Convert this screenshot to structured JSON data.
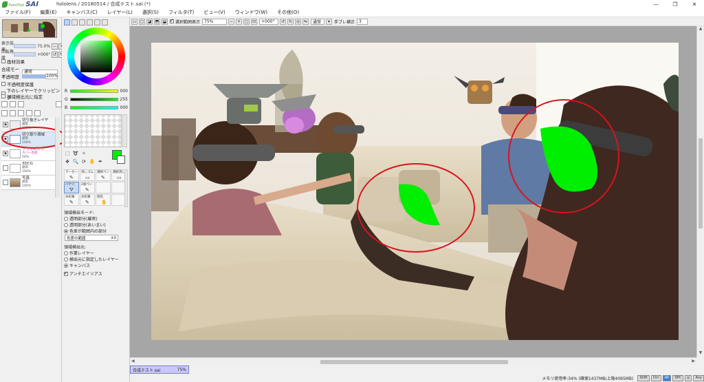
{
  "app": {
    "name": "SAI",
    "brand_small": "PaintTool",
    "window_title": "hololens / 20180514 / 合成テスト.sai (*)",
    "controls": [
      "—",
      "❐",
      "✕"
    ]
  },
  "menu": [
    "ファイル(F)",
    "編集(E)",
    "キャンバス(C)",
    "レイヤー(L)",
    "選択(S)",
    "フィルタ(T)",
    "ビュー(V)",
    "ウィンドウ(W)",
    "その他(O)"
  ],
  "navigator": {
    "zoom_label": "表示倍率",
    "zoom_value": "75.0%",
    "angle_label": "回転角度",
    "angle_value": "+000°"
  },
  "layer_props": {
    "effect_label": "画材効果",
    "blend_label": "合成モード",
    "blend_value": "通常",
    "opacity_label": "不透明度",
    "opacity_value": "100%",
    "options": [
      {
        "label": "不透明度保護",
        "checked": false
      },
      {
        "label": "下のレイヤーでクリッピング",
        "checked": false
      },
      {
        "label": "領域検出元に指定",
        "checked": false
      }
    ]
  },
  "layers": [
    {
      "name": "切り抜きレイヤ",
      "mode": "通常",
      "opacity": "100%",
      "kind": "folder"
    },
    {
      "name": "切り取り領域",
      "mode": "通常",
      "opacity": "100%",
      "kind": "selected"
    },
    {
      "name": "クリッピング",
      "mode": "カバー合成",
      "opacity": "50%",
      "kind": "clip"
    },
    {
      "name": "3DCG",
      "mode": "通常",
      "opacity": "100%",
      "kind": "normal"
    },
    {
      "name": "写真",
      "mode": "通常",
      "opacity": "100%",
      "kind": "photo"
    }
  ],
  "color": {
    "r_label": "R",
    "r_value": "000",
    "g_label": "G",
    "g_value": "255",
    "b_label": "B",
    "b_value": "000",
    "foreground": "#00ee00"
  },
  "brushes": [
    {
      "label": "マーカー",
      "icon": "✎",
      "active": false
    },
    {
      "label": "消しゴム",
      "icon": "▭",
      "active": false
    },
    {
      "label": "選択ペン",
      "icon": "✎",
      "active": false
    },
    {
      "label": "選択消し",
      "icon": "▭",
      "active": false
    },
    {
      "label": "バケツ",
      "icon": "⛛",
      "active": true
    },
    {
      "label": "2値ペン",
      "icon": "✎",
      "active": false
    },
    {
      "label": "",
      "icon": "",
      "active": false
    },
    {
      "label": "",
      "icon": "",
      "active": false
    },
    {
      "label": "水彩筆",
      "icon": "✎",
      "active": false
    },
    {
      "label": "水彩筆",
      "icon": "✎",
      "active": false
    },
    {
      "label": "指先",
      "icon": "✋",
      "active": false
    },
    {
      "label": "",
      "icon": "",
      "active": false
    }
  ],
  "bucket": {
    "mode_title": "領域検出モード:",
    "modes": [
      {
        "label": "透明部分(厳密)",
        "on": false
      },
      {
        "label": "透明部分(あいまい)",
        "on": false
      },
      {
        "label": "色差が範囲内の部分",
        "on": true
      }
    ],
    "range_label": "色差の範囲",
    "range_value": "±0",
    "source_title": "領域検出元:",
    "sources": [
      {
        "label": "作業レイヤー",
        "on": false
      },
      {
        "label": "検出元に指定したレイヤー",
        "on": false
      },
      {
        "label": "キャンバス",
        "on": true
      }
    ],
    "antialias": "アンチエイリアス"
  },
  "toolbar": {
    "selection_label": "選択範囲表示",
    "zoom": "75%",
    "angle": "+000°",
    "mode": "通常",
    "stabilizer_label": "手ブレ補正",
    "stabilizer_value": "3"
  },
  "document_tab": {
    "name": "合成テスト.sai",
    "zoom": "75%"
  },
  "status": {
    "memory": "メモリ使用率:34% (確保1437MB/上限4095MB)",
    "badges": [
      {
        "label": "Shift",
        "on": false
      },
      {
        "label": "Ctrl",
        "on": false
      },
      {
        "label": "Alt",
        "on": true
      },
      {
        "label": "SPC",
        "on": false
      },
      {
        "label": "◎",
        "on": false
      },
      {
        "label": "Any",
        "on": false
      }
    ]
  },
  "colors": {
    "accent": "#00ee00",
    "annotation": "#d8141e",
    "tab": "#c9c9f4"
  }
}
